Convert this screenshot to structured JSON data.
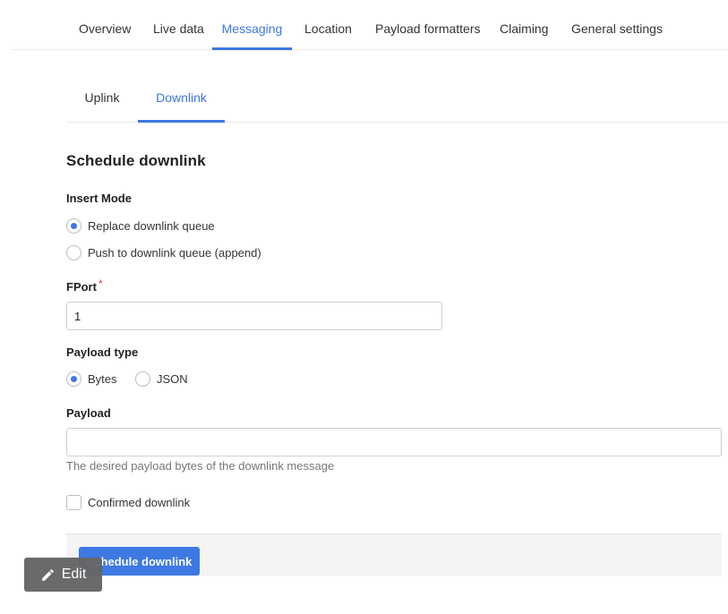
{
  "top_tabs": [
    "Overview",
    "Live data",
    "Messaging",
    "Location",
    "Payload formatters",
    "Claiming",
    "General settings"
  ],
  "sub_tabs": [
    "Uplink",
    "Downlink"
  ],
  "form": {
    "title": "Schedule downlink",
    "insert_mode": {
      "label": "Insert Mode",
      "options": [
        "Replace downlink queue",
        "Push to downlink queue (append)"
      ],
      "selected": "Replace downlink queue"
    },
    "fport": {
      "label": "FPort",
      "required_mark": "*",
      "value": "1"
    },
    "payload_type": {
      "label": "Payload type",
      "options": [
        "Bytes",
        "JSON"
      ],
      "selected": "Bytes"
    },
    "payload": {
      "label": "Payload",
      "value": "",
      "help": "The desired payload bytes of the downlink message"
    },
    "confirmed": {
      "label": "Confirmed downlink",
      "checked": false
    },
    "submit_label": "Schedule downlink"
  },
  "edit_button": {
    "label": "Edit",
    "icon": "pencil-icon"
  },
  "colors": {
    "accent": "#3e78e3",
    "required": "#d9363e",
    "edit_bg": "#666666"
  }
}
